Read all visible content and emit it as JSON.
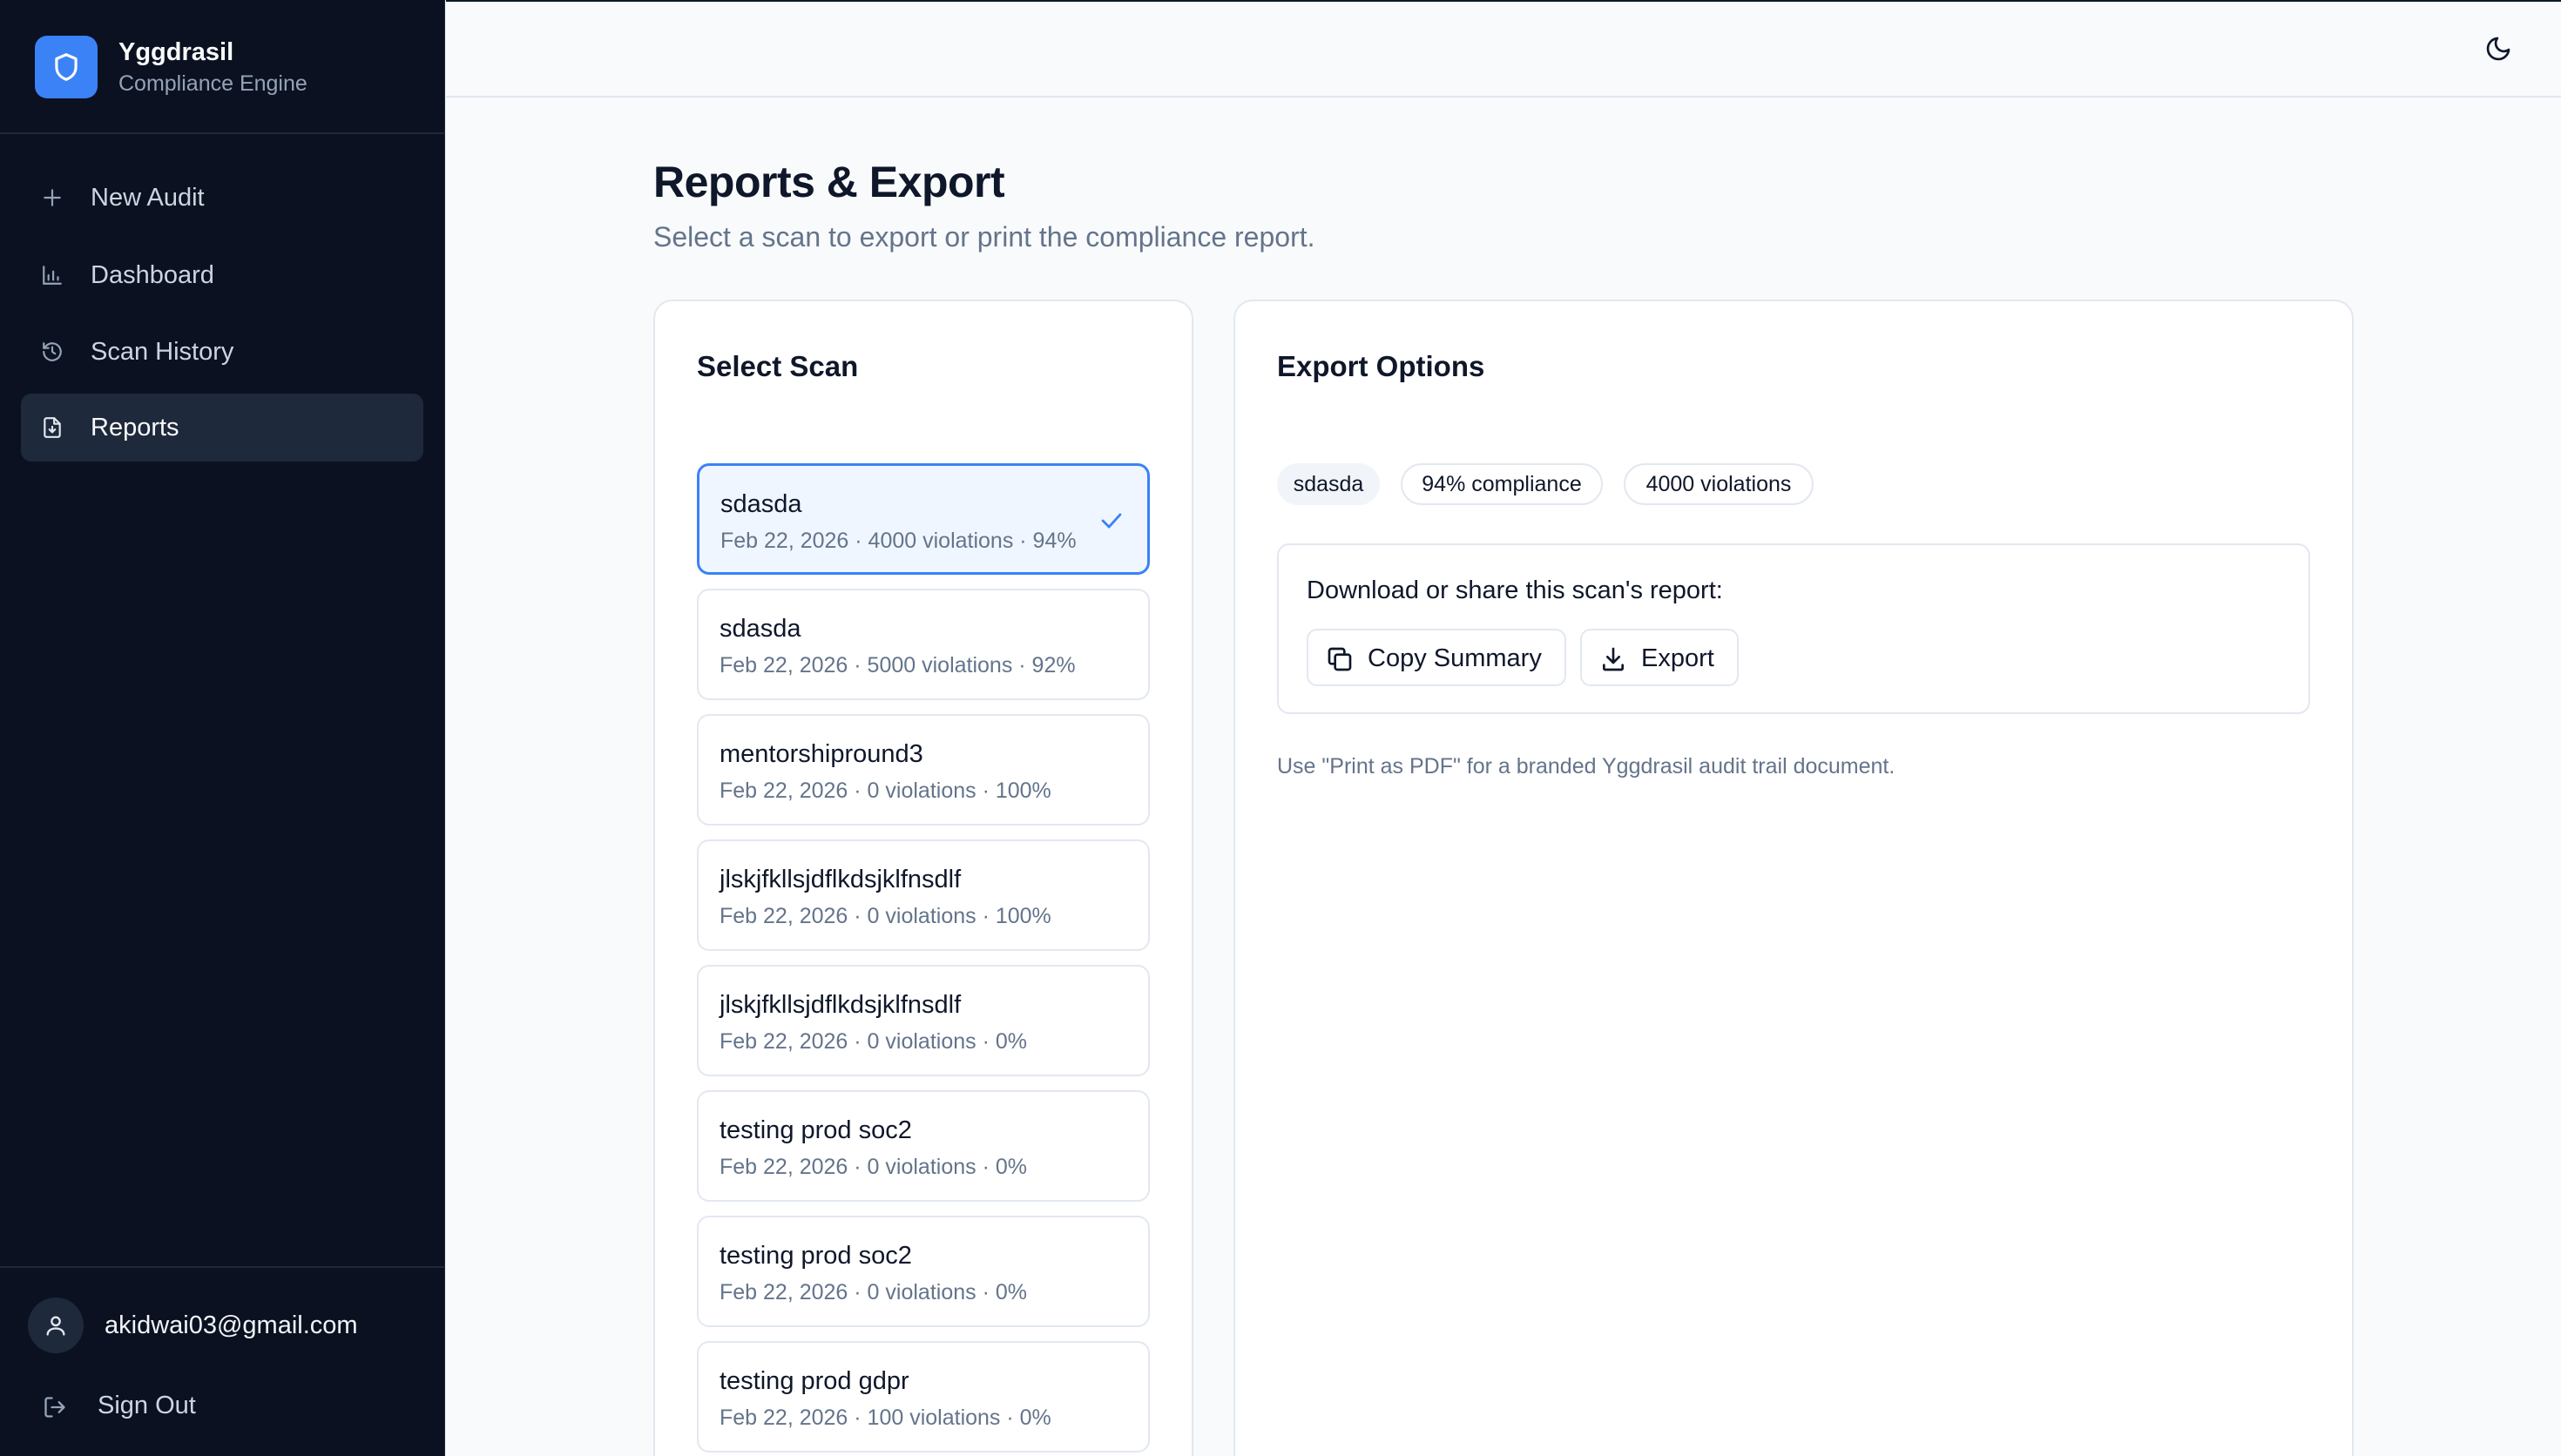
{
  "brand": {
    "title": "Yggdrasil",
    "subtitle": "Compliance Engine"
  },
  "nav": {
    "items": [
      {
        "label": "New Audit",
        "icon": "plus-icon"
      },
      {
        "label": "Dashboard",
        "icon": "bar-chart-icon"
      },
      {
        "label": "Scan History",
        "icon": "history-icon"
      },
      {
        "label": "Reports",
        "icon": "file-download-icon",
        "active": true
      }
    ]
  },
  "user": {
    "email": "akidwai03@gmail.com",
    "signout_label": "Sign Out"
  },
  "topbar": {
    "theme_icon": "moon-icon"
  },
  "page": {
    "title": "Reports & Export",
    "subtitle": "Select a scan to export or print the compliance report."
  },
  "scan_panel": {
    "title": "Select Scan",
    "items": [
      {
        "name": "sdasda",
        "meta": "Feb 22, 2026 · 4000 violations · 94%",
        "selected": true
      },
      {
        "name": "sdasda",
        "meta": "Feb 22, 2026 · 5000 violations · 92%"
      },
      {
        "name": "mentorshipround3",
        "meta": "Feb 22, 2026 · 0 violations · 100%"
      },
      {
        "name": "jlskjfkllsjdflkdsjklfnsdlf",
        "meta": "Feb 22, 2026 · 0 violations · 100%"
      },
      {
        "name": "jlskjfkllsjdflkdsjklfnsdlf",
        "meta": "Feb 22, 2026 · 0 violations · 0%"
      },
      {
        "name": "testing prod soc2",
        "meta": "Feb 22, 2026 · 0 violations · 0%"
      },
      {
        "name": "testing prod soc2",
        "meta": "Feb 22, 2026 · 0 violations · 0%"
      },
      {
        "name": "testing prod gdpr",
        "meta": "Feb 22, 2026 · 100 violations · 0%"
      }
    ]
  },
  "export_panel": {
    "title": "Export Options",
    "chips": [
      "sdasda",
      "94% compliance",
      "4000 violations"
    ],
    "download_label": "Download or share this scan's report:",
    "copy_label": "Copy Summary",
    "export_label": "Export",
    "note": "Use \"Print as PDF\" for a branded Yggdrasil audit trail document."
  },
  "colors": {
    "accent": "#3b82f6",
    "sidebar_bg": "#0b1120",
    "page_bg": "#f8fafc"
  }
}
